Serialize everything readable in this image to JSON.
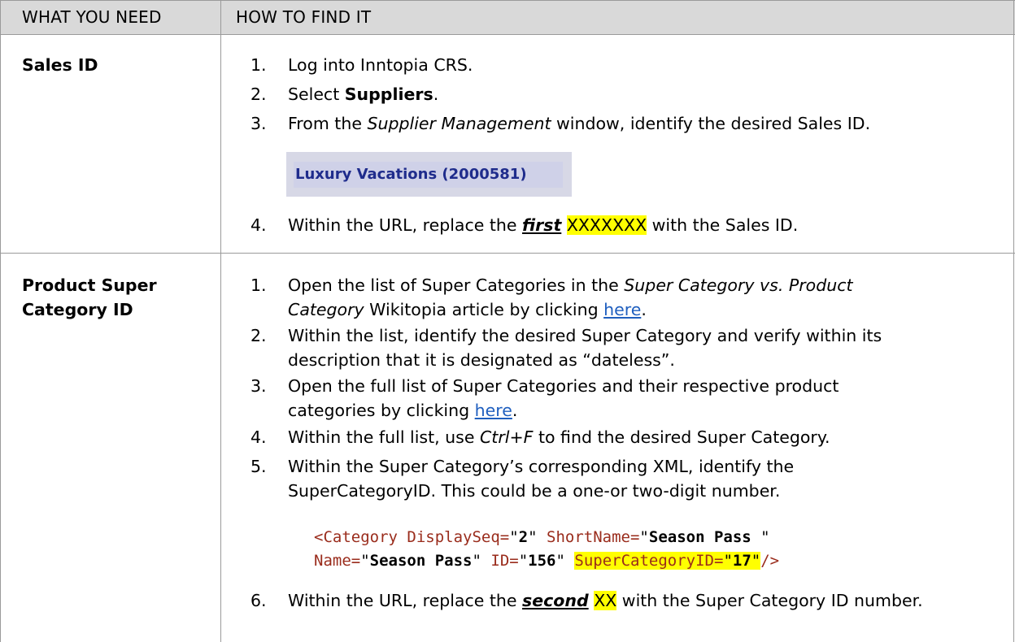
{
  "header": {
    "col1": "WHAT YOU NEED",
    "col2": "HOW TO FIND IT"
  },
  "rows": [
    {
      "label": "Sales ID",
      "steps": [
        {
          "num": "1.",
          "text": "Log into Inntopia CRS."
        },
        {
          "num": "2.",
          "pre": "Select ",
          "bold": "Suppliers",
          "post": "."
        },
        {
          "num": "3.",
          "pre": "From the ",
          "italic": "Supplier Management",
          "post": " window, identify the desired Sales ID."
        },
        {
          "num": "4.",
          "pre": "Within the URL, replace the ",
          "emph": "first",
          "mid": " ",
          "highlight": "XXXXXXX",
          "post": " with the Sales ID."
        }
      ],
      "image_caption": "Luxury Vacations (2000581)"
    },
    {
      "label_line1": "Product Super",
      "label_line2": "Category ID",
      "steps": [
        {
          "num": "1.",
          "l1_pre": "Open the list of Super Categories in the ",
          "l1_italic": "Super Category vs. Product",
          "l2_italic": "Category",
          "l2_mid": " Wikitopia article by clicking ",
          "l2_link": "here",
          "l2_post": "."
        },
        {
          "num": "2.",
          "l1": "Within the list, identify the desired Super Category and verify within its",
          "l2": "description that it is designated as “dateless”."
        },
        {
          "num": "3.",
          "l1": "Open the full list of Super Categories and their respective product",
          "l2_pre": "categories by clicking ",
          "l2_link": "here",
          "l2_post": "."
        },
        {
          "num": "4.",
          "pre": "Within the full list, use ",
          "italic": "Ctrl+F",
          "post": " to find the desired Super Category."
        },
        {
          "num": "5.",
          "l1": "Within the Super Category’s corresponding XML, identify the",
          "l2": "SuperCategoryID.  This could be a one-or two-digit number."
        },
        {
          "num": "6.",
          "pre": "Within the URL, replace the ",
          "emph": "second",
          "mid": " ",
          "highlight": "XX",
          "post": " with the Super Category ID number."
        }
      ],
      "xml": {
        "open": "<Category DisplaySeq=",
        "q": "\"",
        "v_displayseq": "2",
        "attr_shortname": " ShortName=",
        "v_shortname": "Season Pass",
        "sp": " ",
        "attr_name": "Name=",
        "v_name": "Season Pass",
        "attr_id": " ID=",
        "v_id": "156",
        "attr_super": "SuperCategoryID=",
        "v_super": "17",
        "close": "/>"
      }
    }
  ]
}
